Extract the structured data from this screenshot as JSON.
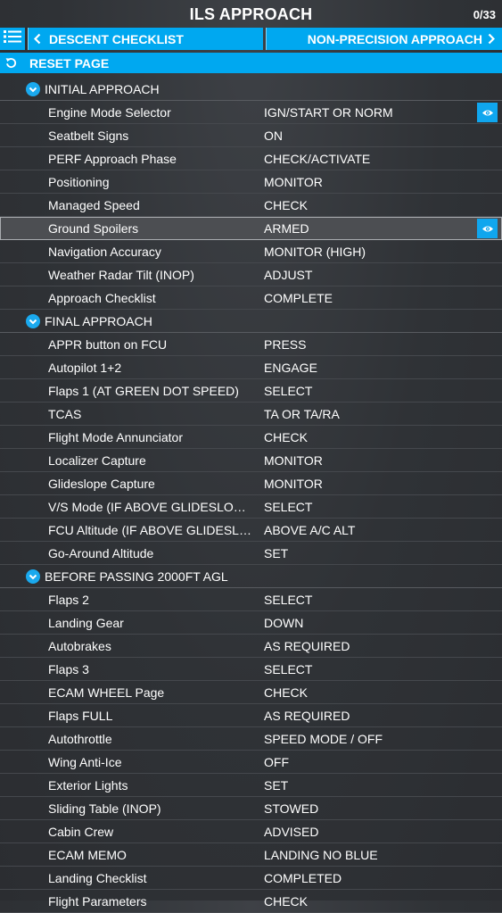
{
  "header": {
    "title": "ILS APPROACH",
    "counter": "0/33"
  },
  "nav": {
    "list_icon": "list-icon",
    "prev_label": "DESCENT CHECKLIST",
    "next_label": "NON-PRECISION APPROACH"
  },
  "reset": {
    "label": "RESET PAGE",
    "icon": "reset-icon"
  },
  "colors": {
    "accent": "#00a8f0",
    "background": "#2f3236",
    "highlight_row": "#4c4e52"
  },
  "sections": [
    {
      "title": "INITIAL APPROACH",
      "items": [
        {
          "name": "Engine Mode Selector",
          "value": "IGN/START OR NORM",
          "eye": true,
          "highlight": false
        },
        {
          "name": "Seatbelt Signs",
          "value": "ON"
        },
        {
          "name": "PERF Approach Phase",
          "value": "CHECK/ACTIVATE"
        },
        {
          "name": "Positioning",
          "value": "MONITOR"
        },
        {
          "name": "Managed Speed",
          "value": "CHECK"
        },
        {
          "name": "Ground Spoilers",
          "value": "ARMED",
          "eye": true,
          "highlight": true
        },
        {
          "name": "Navigation Accuracy",
          "value": "MONITOR (HIGH)"
        },
        {
          "name": "Weather Radar Tilt (INOP)",
          "value": "ADJUST"
        },
        {
          "name": "Approach Checklist",
          "value": "COMPLETE"
        }
      ]
    },
    {
      "title": "FINAL APPROACH",
      "items": [
        {
          "name": "APPR button on FCU",
          "value": "PRESS"
        },
        {
          "name": "Autopilot 1+2",
          "value": "ENGAGE"
        },
        {
          "name": "Flaps 1 (AT GREEN DOT SPEED)",
          "value": "SELECT"
        },
        {
          "name": "TCAS",
          "value": "TA OR TA/RA"
        },
        {
          "name": "Flight Mode Annunciator",
          "value": "CHECK"
        },
        {
          "name": "Localizer Capture",
          "value": "MONITOR"
        },
        {
          "name": "Glideslope Capture",
          "value": "MONITOR"
        },
        {
          "name": "V/S Mode (IF ABOVE GLIDESLOPE)",
          "value": "SELECT"
        },
        {
          "name": "FCU Altitude (IF ABOVE GLIDESLOP…",
          "value": "ABOVE A/C ALT"
        },
        {
          "name": "Go-Around Altitude",
          "value": "SET"
        }
      ]
    },
    {
      "title": "BEFORE PASSING 2000FT AGL",
      "items": [
        {
          "name": "Flaps 2",
          "value": "SELECT"
        },
        {
          "name": "Landing Gear",
          "value": "DOWN"
        },
        {
          "name": "Autobrakes",
          "value": "AS REQUIRED"
        },
        {
          "name": "Flaps 3",
          "value": "SELECT"
        },
        {
          "name": "ECAM WHEEL Page",
          "value": "CHECK"
        },
        {
          "name": "Flaps FULL",
          "value": "AS REQUIRED"
        },
        {
          "name": "Autothrottle",
          "value": "SPEED MODE / OFF"
        },
        {
          "name": "Wing Anti-Ice",
          "value": "OFF"
        },
        {
          "name": "Exterior Lights",
          "value": "SET"
        },
        {
          "name": "Sliding Table (INOP)",
          "value": "STOWED"
        },
        {
          "name": "Cabin Crew",
          "value": "ADVISED"
        },
        {
          "name": "ECAM MEMO",
          "value": "LANDING NO BLUE"
        },
        {
          "name": "Landing Checklist",
          "value": "COMPLETED"
        },
        {
          "name": "Flight Parameters",
          "value": "CHECK"
        }
      ]
    }
  ]
}
